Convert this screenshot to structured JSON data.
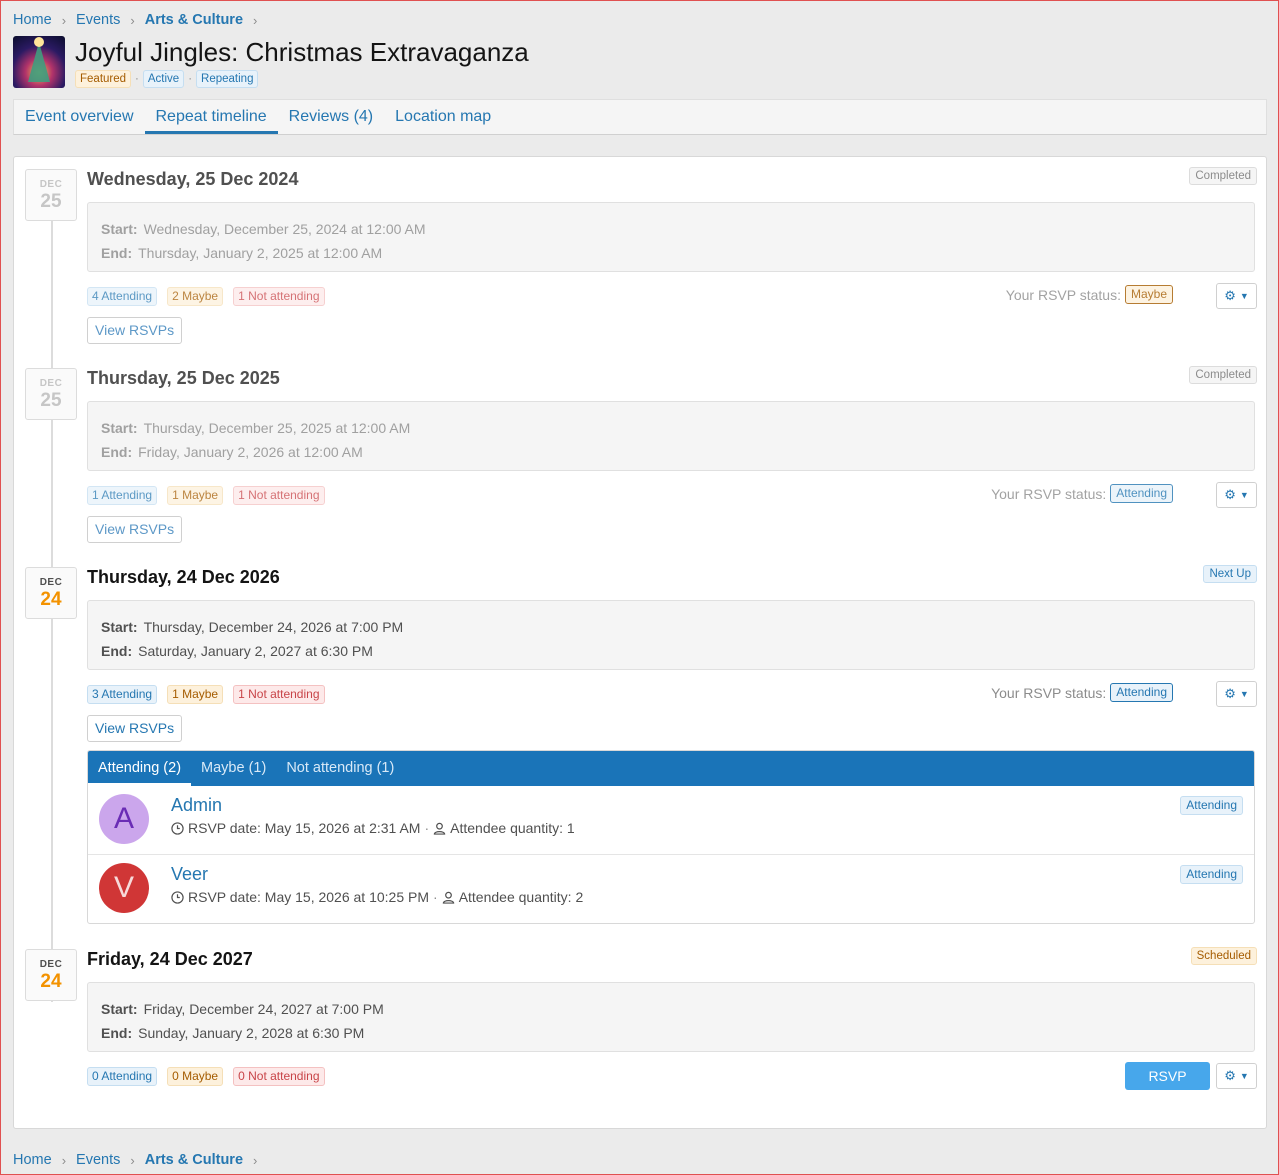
{
  "breadcrumb": [
    {
      "label": "Home"
    },
    {
      "label": "Events"
    },
    {
      "label": "Arts & Culture"
    }
  ],
  "header": {
    "title": "Joyful Jingles: Christmas Extravaganza",
    "tags": [
      "Featured",
      "Active",
      "Repeating"
    ],
    "tag_separator": "·"
  },
  "tabs": [
    "Event overview",
    "Repeat timeline",
    "Reviews (4)",
    "Location map"
  ],
  "labels": {
    "start": "Start:",
    "end": "End:",
    "rsvp_status": "Your RSVP status:",
    "view_rsvps": "View RSVPs",
    "rsvp_button": "RSVP"
  },
  "occurrences": [
    {
      "month": "DEC",
      "day": "25",
      "title": "Wednesday, 25 Dec 2024",
      "status": "Completed",
      "start": "Wednesday, December 25, 2024 at 12:00 AM",
      "end": "Thursday, January 2, 2025 at 12:00 AM",
      "attending": "4 Attending",
      "maybe": "2 Maybe",
      "not_attending": "1 Not attending",
      "your_status": "Maybe"
    },
    {
      "month": "DEC",
      "day": "25",
      "title": "Thursday, 25 Dec 2025",
      "status": "Completed",
      "start": "Thursday, December 25, 2025 at 12:00 AM",
      "end": "Friday, January 2, 2026 at 12:00 AM",
      "attending": "1 Attending",
      "maybe": "1 Maybe",
      "not_attending": "1 Not attending",
      "your_status": "Attending"
    },
    {
      "month": "DEC",
      "day": "24",
      "title": "Thursday, 24 Dec 2026",
      "status": "Next Up",
      "start": "Thursday, December 24, 2026 at 7:00 PM",
      "end": "Saturday, January 2, 2027 at 6:30 PM",
      "attending": "3 Attending",
      "maybe": "1 Maybe",
      "not_attending": "1 Not attending",
      "your_status": "Attending"
    },
    {
      "month": "DEC",
      "day": "24",
      "title": "Friday, 24 Dec 2027",
      "status": "Scheduled",
      "start": "Friday, December 24, 2027 at 7:00 PM",
      "end": "Sunday, January 2, 2028 at 6:30 PM",
      "attending": "0 Attending",
      "maybe": "0 Maybe",
      "not_attending": "0 Not attending"
    }
  ],
  "rsvp_list": {
    "tabs": [
      "Attending (2)",
      "Maybe (1)",
      "Not attending (1)"
    ],
    "entries": [
      {
        "initial": "A",
        "name": "Admin",
        "date": "RSVP date: May 15, 2026 at 2:31 AM",
        "quantity": "Attendee quantity: 1",
        "status": "Attending"
      },
      {
        "initial": "V",
        "name": "Veer",
        "date": "RSVP date: May 15, 2026 at 10:25 PM",
        "quantity": "Attendee quantity: 2",
        "status": "Attending"
      }
    ]
  },
  "icons": {
    "separator": "chevron-right-icon",
    "settings": "gear-icon",
    "dropdown": "caret-down-icon",
    "clock": "clock-icon",
    "user": "user-icon"
  },
  "colors": {
    "accent": "#2577b1",
    "date_highlight": "#f39200",
    "rsvp_tab_bar": "#1a74b8",
    "rsvp_button": "#47a7eb"
  }
}
